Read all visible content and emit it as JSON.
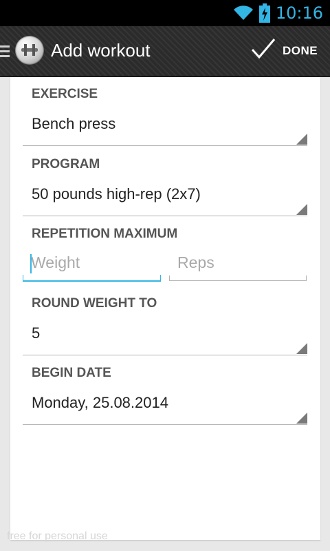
{
  "status_bar": {
    "time": "10:16",
    "wifi_icon": "wifi-icon",
    "battery_icon": "battery-charging-icon"
  },
  "action_bar": {
    "title": "Add workout",
    "done_label": "DONE",
    "icons": {
      "drawer": "drawer-icon",
      "app": "dumbbell-app-icon",
      "done": "check-icon"
    }
  },
  "form": {
    "exercise": {
      "label": "EXERCISE",
      "value": "Bench press"
    },
    "program": {
      "label": "PROGRAM",
      "value": "50 pounds high-rep (2x7)"
    },
    "repetition_maximum": {
      "label": "REPETITION MAXIMUM",
      "weight_placeholder": "Weight",
      "reps_placeholder": "Reps"
    },
    "round_weight": {
      "label": "ROUND WEIGHT TO",
      "value": "5"
    },
    "begin_date": {
      "label": "BEGIN DATE",
      "value": "Monday, 25.08.2014"
    }
  },
  "watermark": "free for personal use",
  "colors": {
    "accent": "#33b5e5",
    "action_bar": "#2b2b2b",
    "background": "#e8e8e8"
  }
}
